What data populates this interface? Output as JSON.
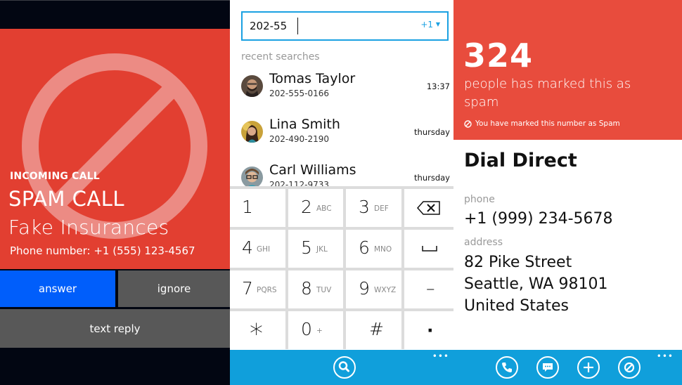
{
  "colors": {
    "call_red": "#e23f31",
    "spam_red": "#e84c3d",
    "answer_blue": "#005efb",
    "button_gray": "#585858",
    "appbar_blue": "#109fdb",
    "accent_blue": "#1ba1e2",
    "dark_bg": "#020612"
  },
  "incoming_call": {
    "label": "INCOMING CALL",
    "title": "SPAM CALL",
    "subtitle": "Fake Insurances",
    "phone_number": "Phone number: +1 (555) 123-4567",
    "background_icon": "ban-icon",
    "buttons": {
      "answer": "answer",
      "ignore": "ignore",
      "text_reply": "text reply"
    }
  },
  "dialer": {
    "search": {
      "value": "202-55",
      "country_code": "+1",
      "country_dropdown_icon": "caret-down-icon"
    },
    "recent_label": "recent searches",
    "contacts": [
      {
        "name": "Tomas Taylor",
        "number": "202-555-0166",
        "time": "13:37"
      },
      {
        "name": "Lina Smith",
        "number": "202-490-2190",
        "time": "thursday"
      },
      {
        "name": "Carl Williams",
        "number": "202-112-9733",
        "time": "thursday"
      }
    ],
    "keys": [
      {
        "digit": "1",
        "letters": ""
      },
      {
        "digit": "2",
        "letters": "ABC"
      },
      {
        "digit": "3",
        "letters": "DEF"
      },
      {
        "digit": "",
        "letters": "",
        "icon": "backspace-icon"
      },
      {
        "digit": "4",
        "letters": "GHI"
      },
      {
        "digit": "5",
        "letters": "JKL"
      },
      {
        "digit": "6",
        "letters": "MNO"
      },
      {
        "digit": "",
        "letters": "",
        "icon": "space-icon"
      },
      {
        "digit": "7",
        "letters": "PQRS"
      },
      {
        "digit": "8",
        "letters": "TUV"
      },
      {
        "digit": "9",
        "letters": "WXYZ"
      },
      {
        "digit": "–",
        "letters": ""
      },
      {
        "digit": "*",
        "letters": ""
      },
      {
        "digit": "0",
        "letters": "+"
      },
      {
        "digit": "#",
        "letters": ""
      },
      {
        "digit": "·",
        "letters": ""
      }
    ],
    "appbar": {
      "search_icon": "search-icon",
      "more": "•••"
    }
  },
  "spam_details": {
    "count": "324",
    "message": "people has marked this as spam",
    "marked_notice": "You have marked this number as Spam",
    "name": "Dial Direct",
    "phone_label": "phone",
    "phone_value": "+1 (999) 234-5678",
    "address_label": "address",
    "address_lines": [
      "82 Pike Street",
      "Seattle, WA 98101",
      "United States"
    ],
    "appbar": {
      "actions": [
        "call-icon",
        "message-icon",
        "add-icon",
        "block-icon"
      ],
      "more": "•••"
    }
  }
}
